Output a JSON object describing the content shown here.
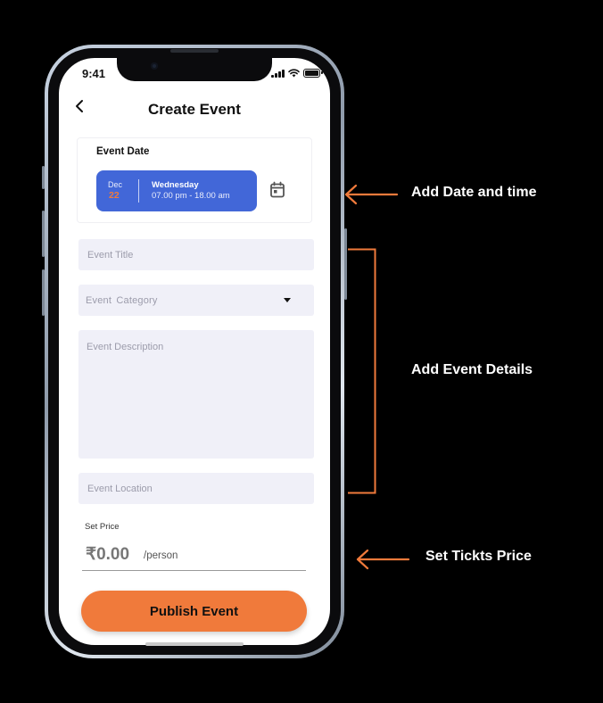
{
  "status_bar": {
    "time": "9:41"
  },
  "header": {
    "title": "Create Event",
    "back_icon": "chevron-left-icon"
  },
  "event_date": {
    "title": "Event Date",
    "month": "Dec",
    "day": "22",
    "weekday": "Wednesday",
    "hours": "07.00 pm - 18.00 am",
    "calendar_icon": "calendar-icon"
  },
  "form": {
    "title_placeholder": "Event Title",
    "category_placeholder": "Event  Category",
    "description_placeholder": "Event Description",
    "location_placeholder": "Event Location"
  },
  "price": {
    "label": "Set Price",
    "amount": "₹0.00",
    "unit": "/person"
  },
  "publish_label": "Publish Event",
  "annotations": {
    "date_time": "Add Date and time",
    "event_details": "Add Event Details",
    "ticket_price": "Set Tickts Price"
  },
  "colors": {
    "accent_orange": "#f07a3b",
    "date_pill_blue": "#4267d8",
    "field_background": "#f0f0f8",
    "background": "#000000"
  }
}
